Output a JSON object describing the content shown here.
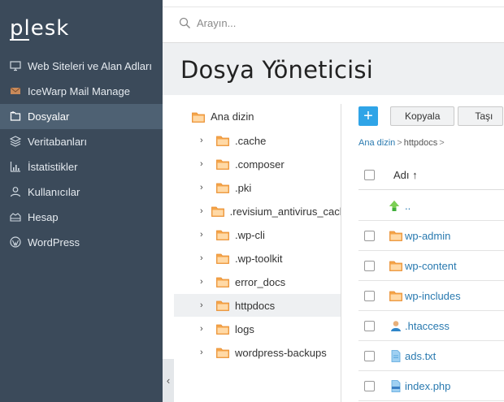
{
  "sidebar": {
    "logo": "plesk",
    "items": [
      {
        "label": "Web Siteleri ve Alan Adları",
        "icon": "monitor-icon"
      },
      {
        "label": "IceWarp Mail Manage",
        "icon": "mail-icon"
      },
      {
        "label": "Dosyalar",
        "icon": "files-icon",
        "active": true
      },
      {
        "label": "Veritabanları",
        "icon": "database-icon"
      },
      {
        "label": "İstatistikler",
        "icon": "chart-icon"
      },
      {
        "label": "Kullanıcılar",
        "icon": "user-icon"
      },
      {
        "label": "Hesap",
        "icon": "account-icon"
      },
      {
        "label": "WordPress",
        "icon": "wordpress-icon"
      }
    ],
    "collapse_label": "‹"
  },
  "search": {
    "placeholder": "Arayın..."
  },
  "page": {
    "title": "Dosya Yöneticisi"
  },
  "tree": {
    "root": "Ana dizin",
    "items": [
      ".cache",
      ".composer",
      ".pki",
      ".revisium_antivirus_cache",
      ".wp-cli",
      ".wp-toolkit",
      "error_docs",
      "httpdocs",
      "logs",
      "wordpress-backups"
    ],
    "selected": "httpdocs"
  },
  "toolbar": {
    "add_label": "+",
    "copy_label": "Kopyala",
    "move_label": "Taşı"
  },
  "breadcrumb": {
    "root": "Ana dizin",
    "sep1": ">",
    "current": "httpdocs",
    "sep2": ">"
  },
  "table": {
    "name_header": "Adı ↑",
    "rows": [
      {
        "name": "..",
        "type": "up"
      },
      {
        "name": "wp-admin",
        "type": "folder"
      },
      {
        "name": "wp-content",
        "type": "folder"
      },
      {
        "name": "wp-includes",
        "type": "folder"
      },
      {
        "name": ".htaccess",
        "type": "user-file"
      },
      {
        "name": "ads.txt",
        "type": "text-file"
      },
      {
        "name": "index.php",
        "type": "php-file"
      }
    ]
  },
  "colors": {
    "sidebar_bg": "#3b4a5a",
    "sidebar_active": "#4e6173",
    "accent": "#2fa4e7",
    "link": "#2a7ab0",
    "folder": "#f5a54a"
  }
}
